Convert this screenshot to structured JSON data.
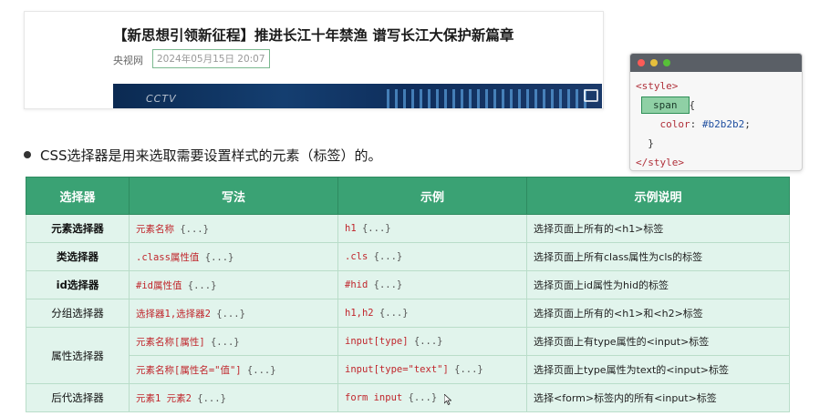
{
  "news": {
    "title": "【新思想引领新征程】推进长江十年禁渔 谱写长江大保护新篇章",
    "source": "央视网",
    "date": "2024年05月15日 20:07"
  },
  "code_window": {
    "line1": "<style>",
    "selector": "span",
    "brace_open": "{",
    "prop": "color",
    "colon": ": ",
    "value": "#b2b2b2",
    "semicolon": ";",
    "brace_close": "}",
    "line_end": "</style>"
  },
  "intro": "CSS选择器是用来选取需要设置样式的元素（标签）的。",
  "table": {
    "headers": [
      "选择器",
      "写法",
      "示例",
      "示例说明"
    ],
    "rows": [
      {
        "name": "元素选择器",
        "syntax": "元素名称",
        "syntax_tail": " {...}",
        "example": "h1",
        "example_tail": " {...}",
        "desc": "选择页面上所有的<h1>标签"
      },
      {
        "name": "类选择器",
        "syntax": ".class属性值",
        "syntax_tail": " {...}",
        "example": ".cls",
        "example_tail": " {...}",
        "desc": "选择页面上所有class属性为cls的标签"
      },
      {
        "name": "id选择器",
        "syntax": "#id属性值",
        "syntax_tail": " {...}",
        "example": "#hid",
        "example_tail": " {...}",
        "desc": "选择页面上id属性为hid的标签"
      },
      {
        "name": "分组选择器",
        "syntax": "选择器1,选择器2",
        "syntax_tail": " {...}",
        "example": "h1,h2",
        "example_tail": " {...}",
        "desc": "选择页面上所有的<h1>和<h2>标签"
      },
      {
        "name": "属性选择器",
        "syntax": "元素名称[属性]",
        "syntax_tail": " {...}",
        "example": "input[type]",
        "example_tail": " {...}",
        "desc": "选择页面上有type属性的<input>标签"
      },
      {
        "name": "",
        "syntax": "元素名称[属性名=\"值\"]",
        "syntax_tail": " {...}",
        "example": "input[type=\"text\"]",
        "example_tail": " {...}",
        "desc": "选择页面上type属性为text的<input>标签"
      },
      {
        "name": "后代选择器",
        "syntax": "元素1 元素2",
        "syntax_tail": " {...}",
        "example": "form input",
        "example_tail": " {...}",
        "desc": "选择<form>标签内的所有<input>标签"
      }
    ]
  },
  "colors": {
    "header_green": "#3aa274",
    "cell_bg": "#e1f4ec",
    "code_red": "#c0262c"
  }
}
